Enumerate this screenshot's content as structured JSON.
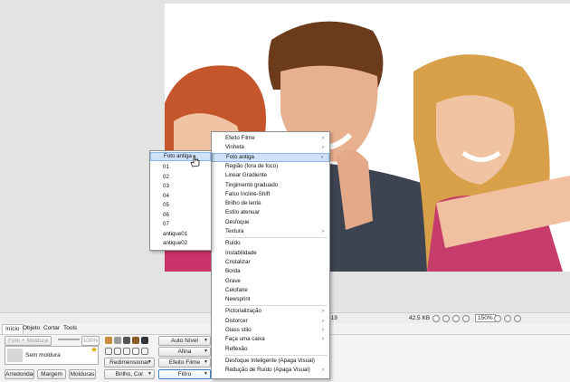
{
  "colors": {
    "accent": "#cfe2fa",
    "arrow": "#e02020"
  },
  "photo": {
    "description_icon": "photo-canvas"
  },
  "status": {
    "dimensions": "419",
    "size": "42.5 KB",
    "zoom": "150%"
  },
  "tabs": [
    "Início",
    "Objeto",
    "Cortar",
    "Tools"
  ],
  "ribbon": {
    "frame_button": "Foto + Moldura",
    "percent": "100%",
    "frame_name": "Sem moldura",
    "rounded": "Arredondado",
    "margin": "Margem",
    "frames": "Molduras",
    "resize": "Redimensionar",
    "brightness": "Brilho, Cor",
    "auto_level": "Auto Nível",
    "sharpen": "Afina",
    "film_effect": "Efeito Filme",
    "filter": "Filtro"
  },
  "menu": {
    "items": [
      {
        "label": "Efeito Filme",
        "sub": true
      },
      {
        "label": "Vinheta",
        "sub": true
      },
      {
        "label": "Foto antiga",
        "sub": true,
        "selected": true
      },
      {
        "label": "Região (fora de foco)",
        "sub": false
      },
      {
        "label": "Linear Gradiente",
        "sub": false
      },
      {
        "label": "Tingimento graduado",
        "sub": false
      },
      {
        "label": "Falso Incline-Shift",
        "sub": false
      },
      {
        "label": "Brilho de lente",
        "sub": false
      },
      {
        "label": "Estilo atenuar",
        "sub": false
      },
      {
        "label": "Desfoque",
        "sub": false
      },
      {
        "label": "Textura",
        "sub": true
      },
      {
        "label": "Ruído",
        "sub": false,
        "sep_before": true
      },
      {
        "label": "Instabilidade",
        "sub": false
      },
      {
        "label": "Cristalizar",
        "sub": false
      },
      {
        "label": "Borda",
        "sub": false
      },
      {
        "label": "Grave",
        "sub": false
      },
      {
        "label": "Celofane",
        "sub": false
      },
      {
        "label": "Newsprint",
        "sub": false
      },
      {
        "label": "Pictorialização",
        "sub": true,
        "sep_before": true
      },
      {
        "label": "Distorcer",
        "sub": true
      },
      {
        "label": "Glass stilo",
        "sub": true
      },
      {
        "label": "Faça uma caixa",
        "sub": true
      },
      {
        "label": "Reflexão",
        "sub": false
      },
      {
        "label": "Desfoque Inteligente (Apaga Visual)",
        "sub": false,
        "sep_before": true
      },
      {
        "label": "Redução de Ruído (Apaga Visual)",
        "sub": true
      }
    ]
  },
  "submenu": {
    "items": [
      "Foto antiga",
      "01",
      "02",
      "03",
      "04",
      "05",
      "06",
      "07",
      "antique01",
      "antique02"
    ]
  }
}
